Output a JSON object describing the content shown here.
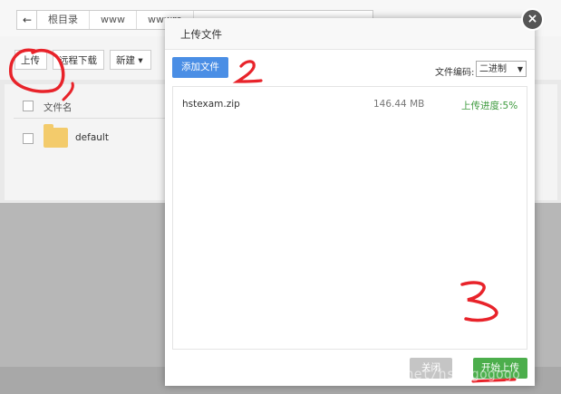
{
  "topbar": {
    "back_symbol": "←",
    "breadcrumbs": [
      "根目录",
      "www",
      "wwwro"
    ]
  },
  "toolbar": {
    "upload": "上传",
    "remote_download": "远程下载",
    "new": "新建",
    "new_caret": "▾"
  },
  "file_table": {
    "column_name": "文件名",
    "rows": [
      {
        "name": "default"
      }
    ]
  },
  "modal": {
    "title": "上传文件",
    "close_symbol": "×",
    "add_button": "添加文件",
    "encoding_label": "文件编码:",
    "encoding_value": "二进制",
    "encoding_arrow": "▼",
    "files": [
      {
        "name": "hstexam.zip",
        "size": "146.44 MB",
        "progress": "上传进度:5%"
      }
    ],
    "close_button": "关闭",
    "start_button": "开始上传"
  },
  "watermark": "https://blog.csdn.net/hst_gogogo",
  "colors": {
    "primary": "#4a8ee5",
    "success": "#4cae4c",
    "progress_text": "#3d9a3d",
    "annotation": "#e8232a"
  }
}
